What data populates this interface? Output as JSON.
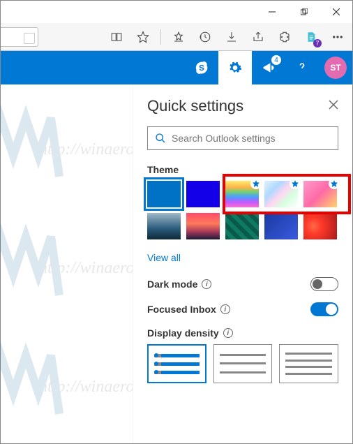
{
  "window": {
    "minimize": "–",
    "maximize": "❐",
    "close": "✕"
  },
  "edge": {
    "notes_badge": "7"
  },
  "o365": {
    "diagnostics_badge": "4",
    "avatar_initials": "ST"
  },
  "panel": {
    "title": "Quick settings",
    "search_placeholder": "Search Outlook settings",
    "theme_label": "Theme",
    "view_all": "View all",
    "dark_mode_label": "Dark mode",
    "dark_mode_on": false,
    "focused_inbox_label": "Focused Inbox",
    "focused_inbox_on": true,
    "display_density_label": "Display density"
  },
  "themes": {
    "row1": [
      "solid-blue",
      "solid-darkblue",
      "rainbow",
      "ribbons",
      "unicorn"
    ],
    "row2": [
      "wave",
      "sunset",
      "circuit",
      "letters",
      "blur-red"
    ]
  },
  "watermark_text": "http://winaero.com"
}
